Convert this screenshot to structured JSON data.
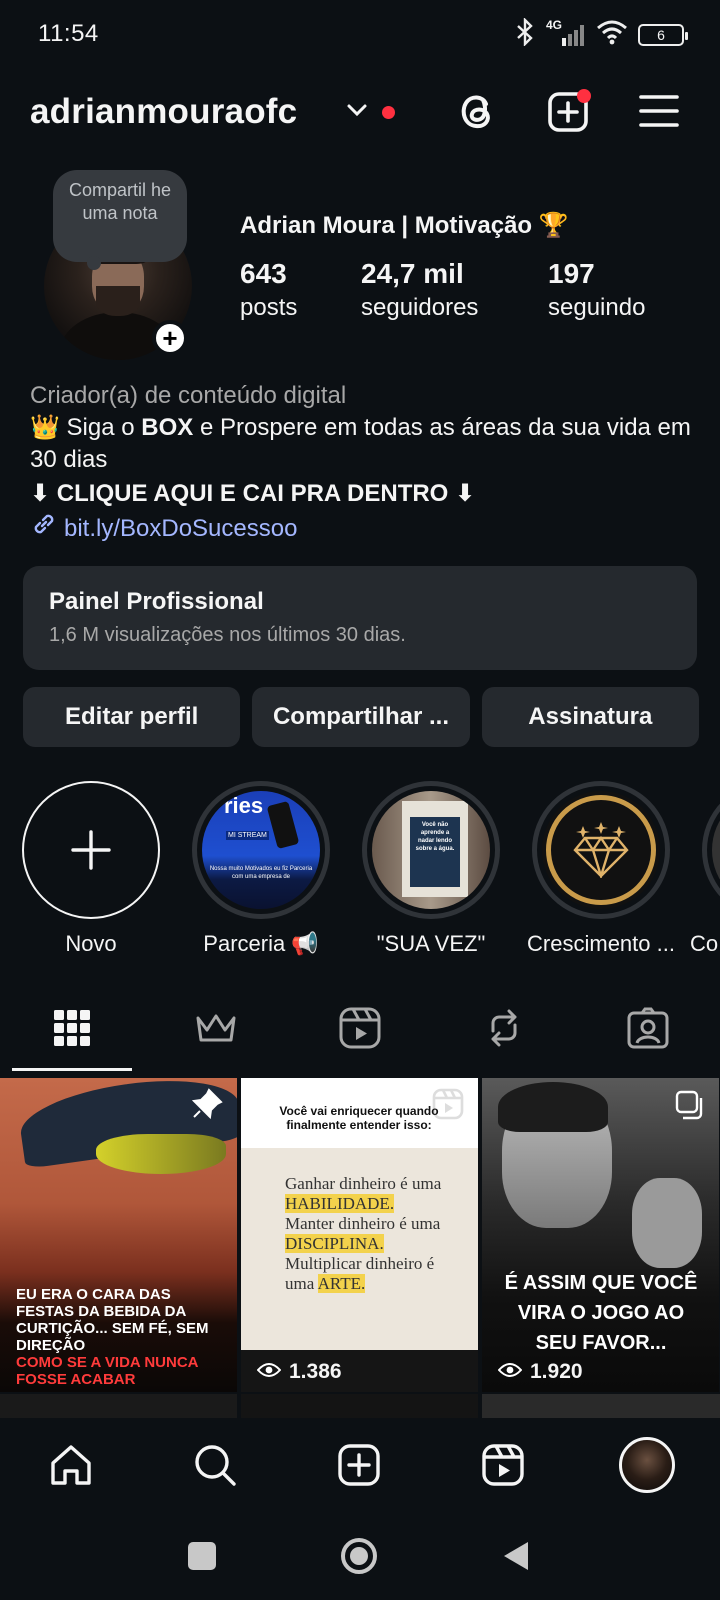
{
  "status_bar": {
    "time": "11:54",
    "network": "4G",
    "battery": "6"
  },
  "header": {
    "username": "adrianmouraofc"
  },
  "profile": {
    "note_bubble": "Compartil he uma nota",
    "name": "Adrian Moura | Motivação 🏆",
    "stats": [
      {
        "value": "643",
        "label": "posts"
      },
      {
        "value": "24,7 mil",
        "label": "seguidores"
      },
      {
        "value": "197",
        "label": "seguindo"
      }
    ],
    "category": "Criador(a) de conteúdo digital",
    "bio_prefix": "👑 Siga o ",
    "bio_bold": "BOX",
    "bio_rest": " e Prospere em todas as áreas da sua vida em 30 dias",
    "cta": "⬇ CLIQUE AQUI E CAI PRA DENTRO ⬇",
    "link": "bit.ly/BoxDoSucessoo"
  },
  "panel": {
    "title": "Painel Profissional",
    "subtitle": "1,6 M visualizações nos últimos 30 dias."
  },
  "buttons": {
    "edit": "Editar perfil",
    "share": "Compartilhar ...",
    "subscription": "Assinatura"
  },
  "highlights": [
    {
      "label": "Novo"
    },
    {
      "label": "Parceria 📢"
    },
    {
      "label": "\"SUA VEZ\""
    },
    {
      "label": "Crescimento ..."
    },
    {
      "label": "Co"
    }
  ],
  "highlight_images": {
    "parceria_text": "ries",
    "parceria_sub": "Nossa muito Motivados eu fiz Parceria com uma empresa de",
    "parceria_stream": "MI STREAM",
    "suavez_text": "Você não aprende a nadar lendo sobre a água."
  },
  "posts": [
    {
      "caption_white": "EU ERA O CARA DAS FESTAS DA BEBIDA DA CURTIÇÃO... SEM FÉ, SEM DIREÇÃO",
      "caption_red": "COMO SE A VIDA NUNCA FOSSE ACABAR"
    },
    {
      "header": "Você vai enriquecer quando finalmente entender isso:",
      "line1a": "Ganhar dinheiro é uma ",
      "line1b": "HABILIDADE.",
      "line2a": "Manter dinheiro é uma ",
      "line2b": "DISCIPLINA.",
      "line3a": "Multiplicar dinheiro é uma ",
      "line3b": "ARTE.",
      "views": "1.386"
    },
    {
      "caption": "É ASSIM QUE VOCÊ VIRA O JOGO AO SEU FAVOR...",
      "views": "1.920"
    }
  ],
  "colors": {
    "background": "#0c1014",
    "surface": "#25292e",
    "link": "#a4b7ff",
    "notification": "#ff3040",
    "highlight_yellow": "#f3d24c"
  }
}
